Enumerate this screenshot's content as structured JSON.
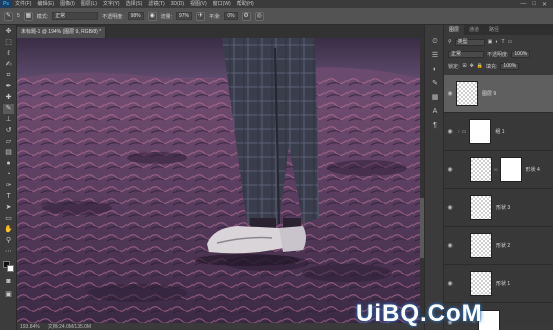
{
  "app": {
    "logo": "Ps"
  },
  "menubar": {
    "items": [
      "文件(F)",
      "编辑(E)",
      "图像(I)",
      "图层(L)",
      "文字(Y)",
      "选择(S)",
      "滤镜(T)",
      "3D(D)",
      "视图(V)",
      "窗口(W)",
      "帮助(H)"
    ],
    "controls": [
      "—",
      "□",
      "✕"
    ]
  },
  "options": {
    "size": "5",
    "mode_label": "模式:",
    "mode_value": "正常",
    "opacity_label": "不透明度:",
    "opacity_value": "98%",
    "flow_label": "流量:",
    "flow_value": "97%",
    "smooth_label": "平滑:",
    "smooth_value": "0%"
  },
  "document": {
    "active_tab": "未标题-1 @ 194% (图层 9, RGB/8) *",
    "other_tab": "",
    "status_zoom": "193.84%",
    "status_doc": "文档:24.0M/135.0M"
  },
  "layers_panel": {
    "tabs": [
      "图层",
      "通道",
      "路径"
    ],
    "filter_label": "类型",
    "blend_mode": "正常",
    "opacity_label": "不透明度:",
    "opacity_value": "100%",
    "lock_label": "锁定:",
    "fill_label": "填充:",
    "fill_value": "100%",
    "layers": [
      {
        "name": "图层 9",
        "selected": true,
        "thumb": "transparent"
      },
      {
        "name": "组 1",
        "selected": false,
        "thumb": "white"
      },
      {
        "name": "形状 4",
        "selected": false,
        "thumb": "transparent"
      },
      {
        "name": "形状 3",
        "selected": false,
        "thumb": "transparent"
      },
      {
        "name": "形状 2",
        "selected": false,
        "thumb": "transparent"
      },
      {
        "name": "形状 1",
        "selected": false,
        "thumb": "transparent"
      }
    ],
    "mask_label_1": "形状 4"
  },
  "watermark": {
    "text": "UiBQ.CoM"
  },
  "colors": {
    "accent": "#31a8ff",
    "canvas_sky": "#5a4766",
    "sand": "#6e4b6e"
  },
  "toolbar_icons": [
    "move-icon",
    "marquee-icon",
    "lasso-icon",
    "quick-select-icon",
    "crop-icon",
    "eyedropper-icon",
    "healing-icon",
    "brush-icon",
    "stamp-icon",
    "history-brush-icon",
    "eraser-icon",
    "gradient-icon",
    "blur-icon",
    "dodge-icon",
    "pen-icon",
    "type-icon",
    "path-select-icon",
    "shape-icon",
    "hand-icon",
    "zoom-icon"
  ]
}
